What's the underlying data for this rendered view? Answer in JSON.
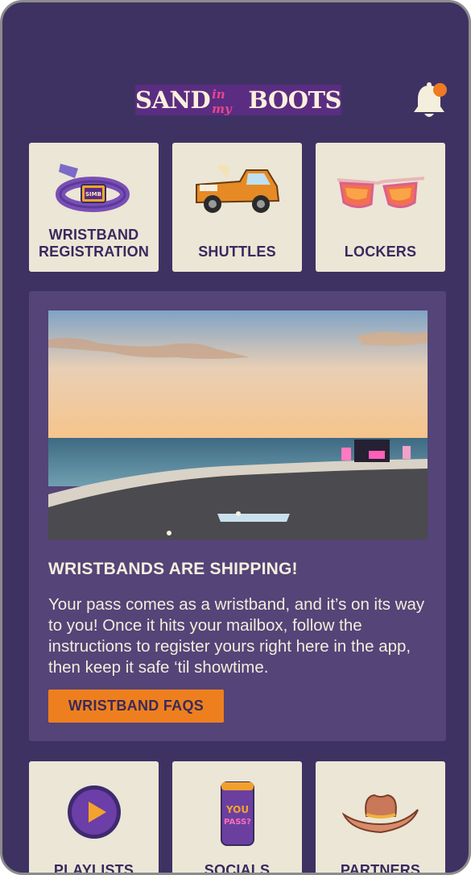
{
  "header": {
    "logo": {
      "word1": "SAND",
      "word2": "in my",
      "word3": "BOOTS"
    }
  },
  "icons": {
    "bell": "bell-icon",
    "notification": "notification-dot"
  },
  "top_tiles": [
    {
      "label_line1": "WRISTBAND",
      "label_line2": "REGISTRATION",
      "icon": "wristband-icon"
    },
    {
      "label": "SHUTTLES",
      "icon": "truck-icon"
    },
    {
      "label": "LOCKERS",
      "icon": "sunglasses-icon"
    }
  ],
  "feature": {
    "title": "WRISTBANDS ARE SHIPPING!",
    "body": "Your pass comes as a wristband, and it’s on its way to you! Once it hits your mailbox, follow the instructions to register yours right here in the app, then keep it safe ‘til showtime.",
    "button_label": "WRISTBAND FAQS",
    "image": "beach-festival-sunset-photo"
  },
  "bottom_tiles": [
    {
      "label": "PLAYLISTS",
      "icon": "play-icon"
    },
    {
      "label": "SOCIALS",
      "icon": "can-icon",
      "can_text_1": "YOU",
      "can_text_2": "PASS?"
    },
    {
      "label": "PARTNERS",
      "icon": "cowboy-hat-icon"
    }
  ],
  "colors": {
    "background": "#3e3263",
    "card": "#544478",
    "tile": "#ece6d6",
    "accent": "#ee7f1f",
    "tile_text": "#372a5e"
  }
}
